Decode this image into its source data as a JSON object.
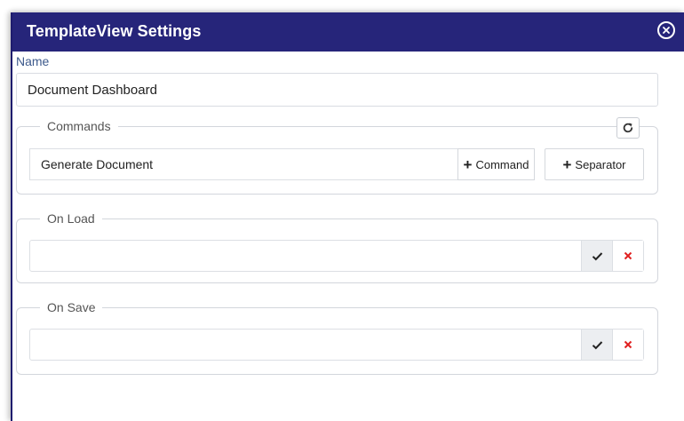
{
  "dialog": {
    "title": "TemplateView Settings",
    "close_icon": "close-circle-icon",
    "header_color": "#26257a"
  },
  "name": {
    "label": "Name",
    "value": "Document Dashboard"
  },
  "commands": {
    "legend": "Commands",
    "refresh_icon": "refresh-icon",
    "items": [
      "Generate Document"
    ],
    "add_command_label": "Command",
    "add_separator_label": "Separator"
  },
  "on_load": {
    "legend": "On Load",
    "value": "",
    "confirm_icon": "check-icon",
    "clear_icon": "x-icon"
  },
  "on_save": {
    "legend": "On Save",
    "value": "",
    "confirm_icon": "check-icon",
    "clear_icon": "x-icon"
  }
}
